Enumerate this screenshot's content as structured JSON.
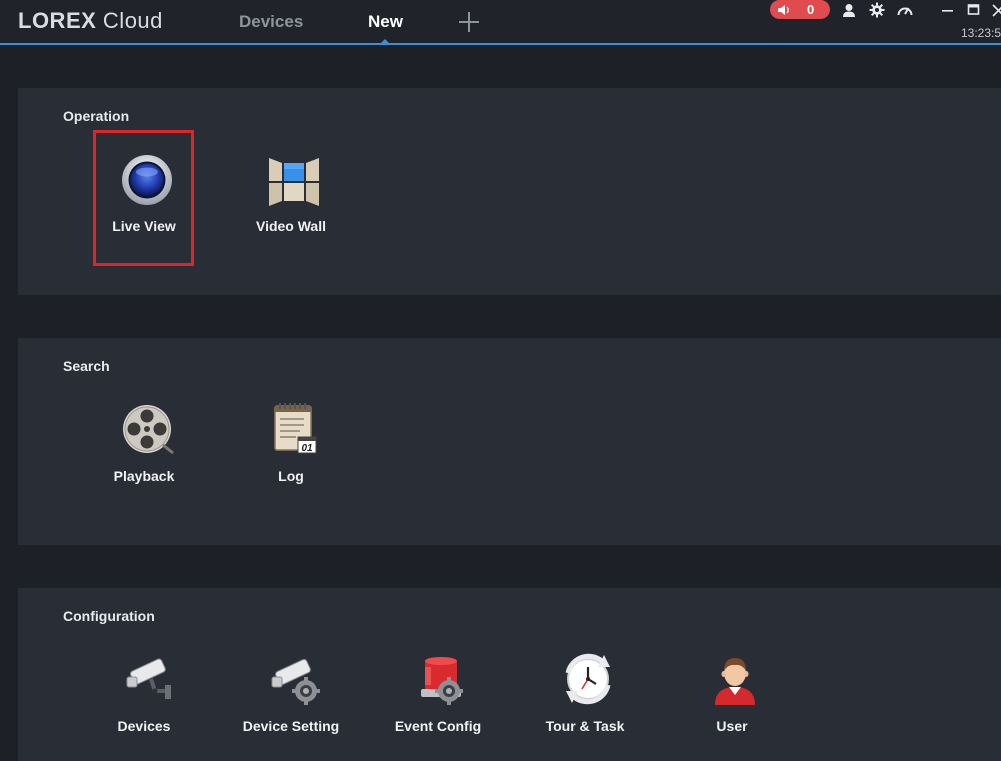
{
  "app": {
    "logo_bold": "LOREX",
    "logo_light": "Cloud",
    "tabs": [
      {
        "label": "Devices",
        "active": false
      },
      {
        "label": "New",
        "active": true
      }
    ],
    "add_tab_icon": "plus-icon",
    "alarm_count": "0",
    "clock": "13:23:5",
    "accent_color": "#3a8fd6",
    "alarm_color": "#e04b4f"
  },
  "sections": [
    {
      "title": "Operation",
      "items": [
        {
          "label": "Live View",
          "icon": "live-view-icon",
          "highlighted": true
        },
        {
          "label": "Video Wall",
          "icon": "video-wall-icon"
        }
      ]
    },
    {
      "title": "Search",
      "items": [
        {
          "label": "Playback",
          "icon": "film-reel-icon"
        },
        {
          "label": "Log",
          "icon": "log-notepad-icon"
        }
      ]
    },
    {
      "title": "Configuration",
      "items": [
        {
          "label": "Devices",
          "icon": "camera-icon"
        },
        {
          "label": "Device Setting",
          "icon": "camera-gear-icon"
        },
        {
          "label": "Event Config",
          "icon": "alarm-gear-icon"
        },
        {
          "label": "Tour & Task",
          "icon": "clock-refresh-icon"
        },
        {
          "label": "User",
          "icon": "user-icon"
        }
      ]
    }
  ],
  "log_icon_text": "01"
}
